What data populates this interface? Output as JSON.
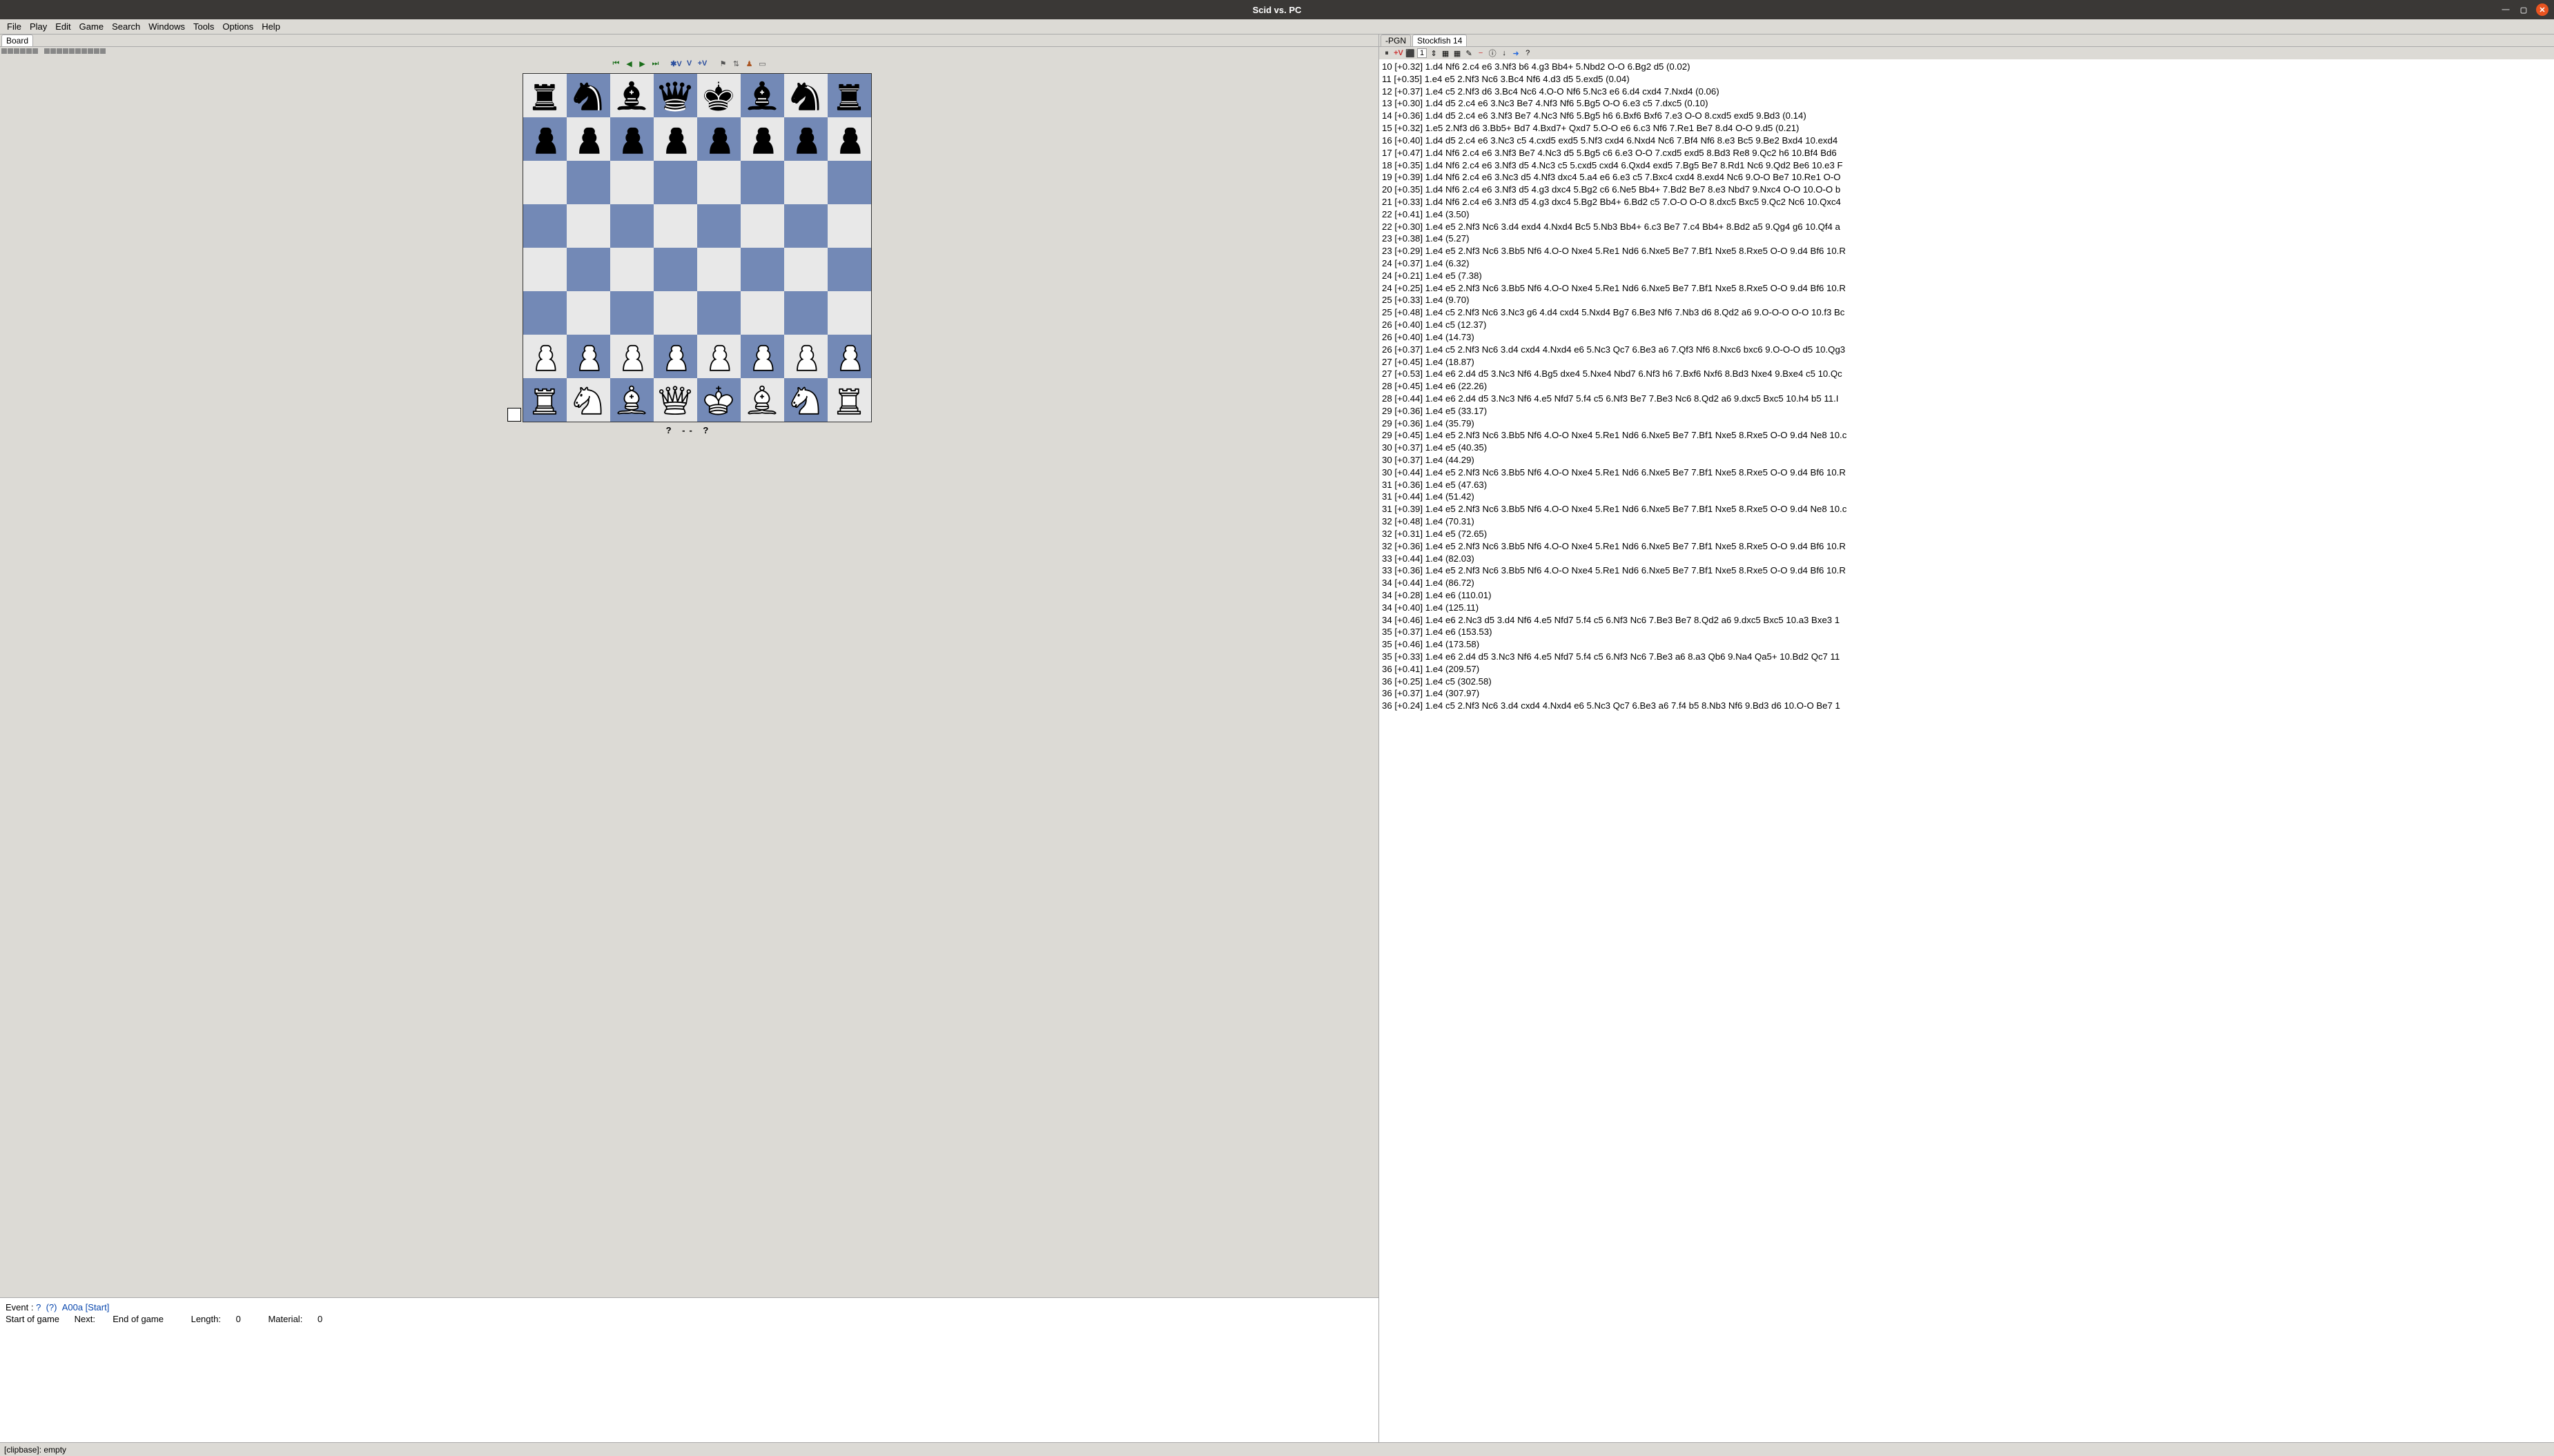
{
  "title": "Scid vs. PC",
  "menubar": [
    "File",
    "Play",
    "Edit",
    "Game",
    "Search",
    "Windows",
    "Tools",
    "Options",
    "Help"
  ],
  "left_tab": "Board",
  "right_tabs": [
    "-PGN",
    "Stockfish 14"
  ],
  "right_active_tab": 1,
  "nav": {
    "sv": "✱V",
    "v": "V",
    "pv": "+V"
  },
  "engine_depth": "1",
  "result_line": "?   --   ?",
  "info": {
    "event_label": "Event :",
    "event_q": "?",
    "event_paren": "(?)",
    "event_code": "A00a [Start]",
    "start": "Start of game",
    "next_label": "Next:",
    "next_val": "End of game",
    "length_label": "Length:",
    "length_val": "0",
    "material_label": "Material:",
    "material_val": "0"
  },
  "statusbar": "[clipbase]:  empty",
  "position": [
    [
      "r",
      "n",
      "b",
      "q",
      "k",
      "b",
      "n",
      "r"
    ],
    [
      "p",
      "p",
      "p",
      "p",
      "p",
      "p",
      "p",
      "p"
    ],
    [
      "",
      "",
      "",
      "",
      "",
      "",
      "",
      ""
    ],
    [
      "",
      "",
      "",
      "",
      "",
      "",
      "",
      ""
    ],
    [
      "",
      "",
      "",
      "",
      "",
      "",
      "",
      ""
    ],
    [
      "",
      "",
      "",
      "",
      "",
      "",
      "",
      ""
    ],
    [
      "P",
      "P",
      "P",
      "P",
      "P",
      "P",
      "P",
      "P"
    ],
    [
      "R",
      "N",
      "B",
      "Q",
      "K",
      "B",
      "N",
      "R"
    ]
  ],
  "analysis_lines": [
    "10 [+0.32]  1.d4 Nf6 2.c4 e6 3.Nf3 b6 4.g3 Bb4+ 5.Nbd2 O-O 6.Bg2 d5  (0.02)",
    "11 [+0.35]  1.e4 e5 2.Nf3 Nc6 3.Bc4 Nf6 4.d3 d5 5.exd5  (0.04)",
    "12 [+0.37]  1.e4 c5 2.Nf3 d6 3.Bc4 Nc6 4.O-O Nf6 5.Nc3 e6 6.d4 cxd4 7.Nxd4  (0.06)",
    "13 [+0.30]  1.d4 d5 2.c4 e6 3.Nc3 Be7 4.Nf3 Nf6 5.Bg5 O-O 6.e3 c5 7.dxc5  (0.10)",
    "14 [+0.36]  1.d4 d5 2.c4 e6 3.Nf3 Be7 4.Nc3 Nf6 5.Bg5 h6 6.Bxf6 Bxf6 7.e3 O-O 8.cxd5 exd5 9.Bd3  (0.14)",
    "15 [+0.32]  1.e5 2.Nf3 d6 3.Bb5+ Bd7 4.Bxd7+ Qxd7 5.O-O e6 6.c3 Nf6 7.Re1 Be7 8.d4 O-O 9.d5  (0.21)",
    "16 [+0.40]  1.d4 d5 2.c4 e6 3.Nc3 c5 4.cxd5 exd5 5.Nf3 cxd4 6.Nxd4 Nc6 7.Bf4 Nf6 8.e3 Bc5 9.Be2 Bxd4 10.exd4",
    "17 [+0.47]  1.d4 Nf6 2.c4 e6 3.Nf3 Be7 4.Nc3 d5 5.Bg5 c6 6.e3 O-O 7.cxd5 exd5 8.Bd3 Re8 9.Qc2 h6 10.Bf4 Bd6",
    "18 [+0.35]  1.d4 Nf6 2.c4 e6 3.Nf3 d5 4.Nc3 c5 5.cxd5 cxd4 6.Qxd4 exd5 7.Bg5 Be7 8.Rd1 Nc6 9.Qd2 Be6 10.e3 F",
    "19 [+0.39]  1.d4 Nf6 2.c4 e6 3.Nc3 d5 4.Nf3 dxc4 5.a4 e6 6.e3 c5 7.Bxc4 cxd4 8.exd4 Nc6 9.O-O Be7 10.Re1 O-O",
    "20 [+0.35]  1.d4 Nf6 2.c4 e6 3.Nf3 d5 4.g3 dxc4 5.Bg2 c6 6.Ne5 Bb4+ 7.Bd2 Be7 8.e3 Nbd7 9.Nxc4 O-O 10.O-O b",
    "21 [+0.33]  1.d4 Nf6 2.c4 e6 3.Nf3 d5 4.g3 dxc4 5.Bg2 Bb4+ 6.Bd2 c5 7.O-O O-O 8.dxc5 Bxc5 9.Qc2 Nc6 10.Qxc4",
    "22 [+0.41]  1.e4  (3.50)",
    "22 [+0.30]  1.e4 e5 2.Nf3 Nc6 3.d4 exd4 4.Nxd4 Bc5 5.Nb3 Bb4+ 6.c3 Be7 7.c4 Bb4+ 8.Bd2 a5 9.Qg4 g6 10.Qf4 a",
    "23 [+0.38]  1.e4  (5.27)",
    "23 [+0.29]  1.e4 e5 2.Nf3 Nc6 3.Bb5 Nf6 4.O-O Nxe4 5.Re1 Nd6 6.Nxe5 Be7 7.Bf1 Nxe5 8.Rxe5 O-O 9.d4 Bf6 10.R",
    "24 [+0.37]  1.e4  (6.32)",
    "24 [+0.21]  1.e4 e5  (7.38)",
    "24 [+0.25]  1.e4 e5 2.Nf3 Nc6 3.Bb5 Nf6 4.O-O Nxe4 5.Re1 Nd6 6.Nxe5 Be7 7.Bf1 Nxe5 8.Rxe5 O-O 9.d4 Bf6 10.R",
    "25 [+0.33]  1.e4  (9.70)",
    "25 [+0.48]  1.e4 c5 2.Nf3 Nc6 3.Nc3 g6 4.d4 cxd4 5.Nxd4 Bg7 6.Be3 Nf6 7.Nb3 d6 8.Qd2 a6 9.O-O-O O-O 10.f3 Bc",
    "26 [+0.40]  1.e4 c5  (12.37)",
    "26 [+0.40]  1.e4  (14.73)",
    "26 [+0.37]  1.e4 c5 2.Nf3 Nc6 3.d4 cxd4 4.Nxd4 e6 5.Nc3 Qc7 6.Be3 a6 7.Qf3 Nf6 8.Nxc6 bxc6 9.O-O-O d5 10.Qg3",
    "27 [+0.45]  1.e4  (18.87)",
    "27 [+0.53]  1.e4 e6 2.d4 d5 3.Nc3 Nf6 4.Bg5 dxe4 5.Nxe4 Nbd7 6.Nf3 h6 7.Bxf6 Nxf6 8.Bd3 Nxe4 9.Bxe4 c5 10.Qc",
    "28 [+0.45]  1.e4 e6  (22.26)",
    "28 [+0.44]  1.e4 e6 2.d4 d5 3.Nc3 Nf6 4.e5 Nfd7 5.f4 c5 6.Nf3 Be7 7.Be3 Nc6 8.Qd2 a6 9.dxc5 Bxc5 10.h4 b5 11.I",
    "29 [+0.36]  1.e4 e5  (33.17)",
    "29 [+0.36]  1.e4  (35.79)",
    "29 [+0.45]  1.e4 e5 2.Nf3 Nc6 3.Bb5 Nf6 4.O-O Nxe4 5.Re1 Nd6 6.Nxe5 Be7 7.Bf1 Nxe5 8.Rxe5 O-O 9.d4 Ne8 10.c",
    "30 [+0.37]  1.e4 e5  (40.35)",
    "30 [+0.37]  1.e4  (44.29)",
    "30 [+0.44]  1.e4 e5 2.Nf3 Nc6 3.Bb5 Nf6 4.O-O Nxe4 5.Re1 Nd6 6.Nxe5 Be7 7.Bf1 Nxe5 8.Rxe5 O-O 9.d4 Bf6 10.R",
    "31 [+0.36]  1.e4 e5  (47.63)",
    "31 [+0.44]  1.e4  (51.42)",
    "31 [+0.39]  1.e4 e5 2.Nf3 Nc6 3.Bb5 Nf6 4.O-O Nxe4 5.Re1 Nd6 6.Nxe5 Be7 7.Bf1 Nxe5 8.Rxe5 O-O 9.d4 Ne8 10.c",
    "32 [+0.48]  1.e4  (70.31)",
    "32 [+0.31]  1.e4 e5  (72.65)",
    "32 [+0.36]  1.e4 e5 2.Nf3 Nc6 3.Bb5 Nf6 4.O-O Nxe4 5.Re1 Nd6 6.Nxe5 Be7 7.Bf1 Nxe5 8.Rxe5 O-O 9.d4 Bf6 10.R",
    "33 [+0.44]  1.e4  (82.03)",
    "33 [+0.36]  1.e4 e5 2.Nf3 Nc6 3.Bb5 Nf6 4.O-O Nxe4 5.Re1 Nd6 6.Nxe5 Be7 7.Bf1 Nxe5 8.Rxe5 O-O 9.d4 Bf6 10.R",
    "34 [+0.44]  1.e4  (86.72)",
    "34 [+0.28]  1.e4 e6  (110.01)",
    "34 [+0.40]  1.e4  (125.11)",
    "34 [+0.46]  1.e4 e6 2.Nc3 d5 3.d4 Nf6 4.e5 Nfd7 5.f4 c5 6.Nf3 Nc6 7.Be3 Be7 8.Qd2 a6 9.dxc5 Bxc5 10.a3 Bxe3 1",
    "35 [+0.37]  1.e4 e6  (153.53)",
    "35 [+0.46]  1.e4  (173.58)",
    "35 [+0.33]  1.e4 e6 2.d4 d5 3.Nc3 Nf6 4.e5 Nfd7 5.f4 c5 6.Nf3 Nc6 7.Be3 a6 8.a3 Qb6 9.Na4 Qa5+ 10.Bd2 Qc7 11",
    "36 [+0.41]  1.e4  (209.57)",
    "36 [+0.25]  1.e4 c5  (302.58)",
    "36 [+0.37]  1.e4  (307.97)",
    "36 [+0.24]  1.e4 c5 2.Nf3 Nc6 3.d4 cxd4 4.Nxd4 e6 5.Nc3 Qc7 6.Be3 a6 7.f4 b5 8.Nb3 Nf6 9.Bd3 d6 10.O-O Be7 1"
  ]
}
